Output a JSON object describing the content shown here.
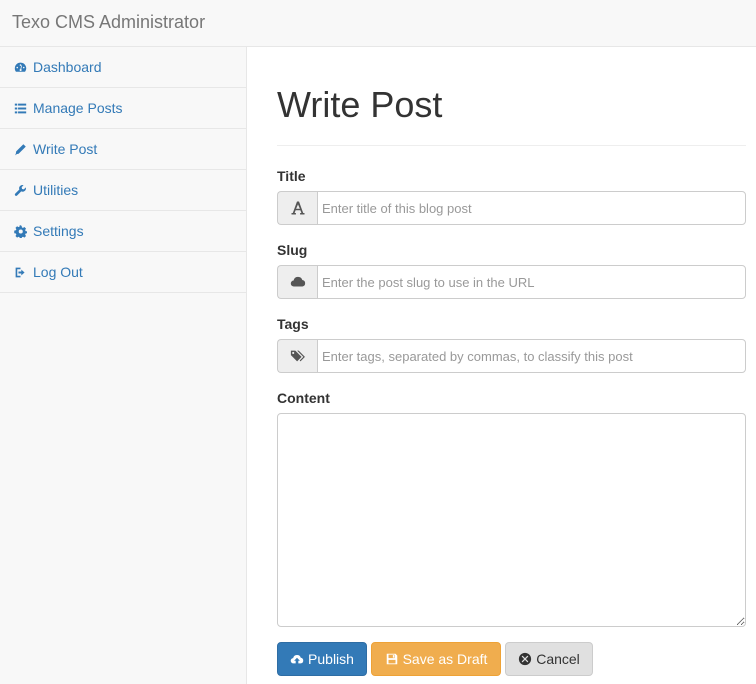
{
  "app": {
    "brand": "Texo CMS Administrator"
  },
  "sidebar": {
    "items": [
      {
        "label": "Dashboard",
        "icon": "dashboard-icon"
      },
      {
        "label": "Manage Posts",
        "icon": "list-icon"
      },
      {
        "label": "Write Post",
        "icon": "pencil-icon"
      },
      {
        "label": "Utilities",
        "icon": "wrench-icon"
      },
      {
        "label": "Settings",
        "icon": "gear-icon"
      },
      {
        "label": "Log Out",
        "icon": "logout-icon"
      }
    ]
  },
  "page": {
    "title": "Write Post"
  },
  "form": {
    "title": {
      "label": "Title",
      "placeholder": "Enter title of this blog post",
      "icon": "font-icon"
    },
    "slug": {
      "label": "Slug",
      "placeholder": "Enter the post slug to use in the URL",
      "icon": "cloud-icon"
    },
    "tags": {
      "label": "Tags",
      "placeholder": "Enter tags, separated by commas, to classify this post",
      "icon": "tags-icon"
    },
    "content": {
      "label": "Content",
      "value": ""
    }
  },
  "buttons": {
    "publish": {
      "label": "Publish",
      "icon": "cloud-upload-icon",
      "color": "#337ab7"
    },
    "draft": {
      "label": "Save as Draft",
      "icon": "floppy-icon",
      "color": "#f0ad4e"
    },
    "cancel": {
      "label": "Cancel",
      "icon": "close-circle-icon",
      "color": "#e0e0e0"
    }
  }
}
